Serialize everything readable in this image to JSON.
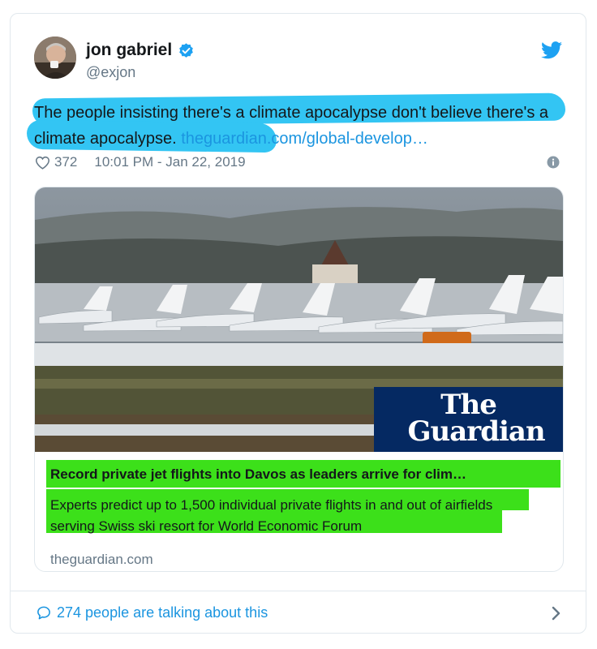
{
  "tweet": {
    "author_name": "jon gabriel",
    "author_handle": "@exjon",
    "text_main": "The people insisting there's a climate apocalypse don't believe there's a climate apocalypse.",
    "text_link": "theguardian.com/global-develop…",
    "likes": "372",
    "timestamp": "10:01 PM - Jan 22, 2019"
  },
  "link_card": {
    "publisher_logo": "The Guardian",
    "title": "Record private jet flights into Davos as leaders arrive for clim…",
    "description": "Experts predict up to 1,500 individual private flights in and out of airfields serving Swiss ski resort for World Economic Forum",
    "domain": "theguardian.com"
  },
  "footer": {
    "talking": "274 people are talking about this"
  },
  "colors": {
    "link_blue": "#1b95e0",
    "highlight_blue": "#33c5f3",
    "highlight_green": "#3ce01a",
    "guardian_navy": "#052962",
    "secondary_text": "#657786"
  },
  "icons": [
    "verified-badge-icon",
    "twitter-bird-icon",
    "heart-icon",
    "info-icon",
    "speech-bubble-icon",
    "chevron-right-icon"
  ]
}
